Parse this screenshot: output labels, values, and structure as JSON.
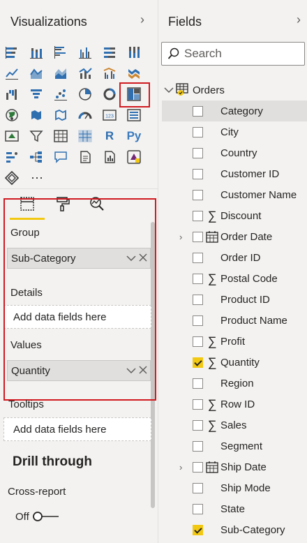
{
  "visualizations": {
    "title": "Visualizations",
    "more_label": "···",
    "icons": [
      "stacked-bar-chart-icon",
      "stacked-column-chart-icon",
      "clustered-bar-chart-icon",
      "clustered-column-chart-icon",
      "100-stacked-bar-chart-icon",
      "100-stacked-column-chart-icon",
      "line-chart-icon",
      "area-chart-icon",
      "stacked-area-chart-icon",
      "line-and-column-chart-icon",
      "line-and-clustered-column-chart-icon",
      "ribbon-chart-icon",
      "waterfall-chart-icon",
      "funnel-chart-icon",
      "scatter-chart-icon",
      "pie-chart-icon",
      "donut-chart-icon",
      "treemap-icon",
      "map-icon",
      "filled-map-icon",
      "shape-map-icon",
      "gauge-icon",
      "card-icon",
      "multi-row-card-icon",
      "kpi-icon",
      "slicer-icon",
      "table-icon",
      "matrix-icon",
      "r-script-visual-icon",
      "python-visual-icon",
      "key-influencers-icon",
      "decomposition-tree-icon",
      "qa-icon",
      "smart-narrative-icon",
      "paginated-report-icon",
      "power-apps-icon",
      "arcgis-icon",
      "more-visuals-icon"
    ],
    "card_text": "123",
    "r_text": "R",
    "py_text": "Py",
    "wells": {
      "group_label": "Group",
      "group_field": "Sub-Category",
      "details_label": "Details",
      "details_placeholder": "Add data fields here",
      "values_label": "Values",
      "values_field": "Quantity",
      "tooltips_label": "Tooltips",
      "tooltips_placeholder": "Add data fields here"
    },
    "drill_through": {
      "title": "Drill through",
      "cross_report_label": "Cross-report",
      "toggle_state": "Off"
    }
  },
  "fields": {
    "title": "Fields",
    "search_placeholder": "Search",
    "table_name": "Orders",
    "items": [
      {
        "name": "Category",
        "type": "",
        "checked": false,
        "highlight": true,
        "expandable": false
      },
      {
        "name": "City",
        "type": "",
        "checked": false,
        "highlight": false,
        "expandable": false
      },
      {
        "name": "Country",
        "type": "",
        "checked": false,
        "highlight": false,
        "expandable": false
      },
      {
        "name": "Customer ID",
        "type": "",
        "checked": false,
        "highlight": false,
        "expandable": false
      },
      {
        "name": "Customer Name",
        "type": "",
        "checked": false,
        "highlight": false,
        "expandable": false
      },
      {
        "name": "Discount",
        "type": "sum",
        "checked": false,
        "highlight": false,
        "expandable": false
      },
      {
        "name": "Order Date",
        "type": "date",
        "checked": false,
        "highlight": false,
        "expandable": true
      },
      {
        "name": "Order ID",
        "type": "",
        "checked": false,
        "highlight": false,
        "expandable": false
      },
      {
        "name": "Postal Code",
        "type": "sum",
        "checked": false,
        "highlight": false,
        "expandable": false
      },
      {
        "name": "Product ID",
        "type": "",
        "checked": false,
        "highlight": false,
        "expandable": false
      },
      {
        "name": "Product Name",
        "type": "",
        "checked": false,
        "highlight": false,
        "expandable": false
      },
      {
        "name": "Profit",
        "type": "sum",
        "checked": false,
        "highlight": false,
        "expandable": false
      },
      {
        "name": "Quantity",
        "type": "sum",
        "checked": true,
        "highlight": false,
        "expandable": false
      },
      {
        "name": "Region",
        "type": "",
        "checked": false,
        "highlight": false,
        "expandable": false
      },
      {
        "name": "Row ID",
        "type": "sum",
        "checked": false,
        "highlight": false,
        "expandable": false
      },
      {
        "name": "Sales",
        "type": "sum",
        "checked": false,
        "highlight": false,
        "expandable": false
      },
      {
        "name": "Segment",
        "type": "",
        "checked": false,
        "highlight": false,
        "expandable": false
      },
      {
        "name": "Ship Date",
        "type": "date",
        "checked": false,
        "highlight": false,
        "expandable": true
      },
      {
        "name": "Ship Mode",
        "type": "",
        "checked": false,
        "highlight": false,
        "expandable": false
      },
      {
        "name": "State",
        "type": "",
        "checked": false,
        "highlight": false,
        "expandable": false
      },
      {
        "name": "Sub-Category",
        "type": "",
        "checked": true,
        "highlight": false,
        "expandable": false
      }
    ]
  },
  "colors": {
    "accent_yellow": "#f2c811",
    "highlight_red": "#d0191f",
    "icon_blue": "#2f6fb0"
  }
}
